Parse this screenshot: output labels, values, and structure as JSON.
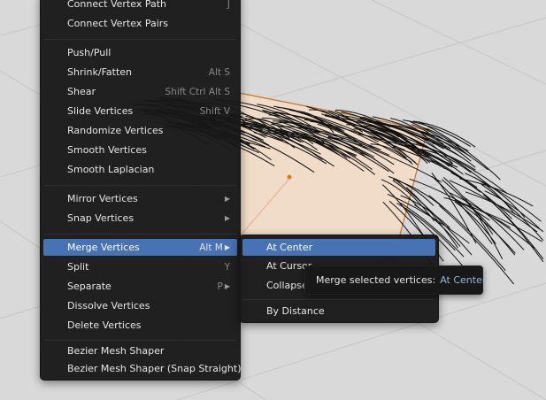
{
  "edge_menu": {
    "items": [
      {
        "label": "Connect Vertex Path",
        "shortcut": "J"
      },
      {
        "label": "Connect Vertex Pairs",
        "shortcut": ""
      },
      {
        "label": "Push/Pull",
        "shortcut": ""
      },
      {
        "label": "Shrink/Fatten",
        "shortcut": "Alt S"
      },
      {
        "label": "Shear",
        "shortcut": "Shift Ctrl Alt S"
      },
      {
        "label": "Slide Vertices",
        "shortcut": "Shift V"
      },
      {
        "label": "Randomize Vertices",
        "shortcut": ""
      },
      {
        "label": "Smooth Vertices",
        "shortcut": ""
      },
      {
        "label": "Smooth Laplacian",
        "shortcut": ""
      },
      {
        "label": "Mirror Vertices",
        "shortcut": "",
        "submenu": true
      },
      {
        "label": "Snap Vertices",
        "shortcut": "",
        "submenu": true
      },
      {
        "label": "Merge Vertices",
        "shortcut": "Alt M",
        "submenu": true,
        "active": true
      },
      {
        "label": "Split",
        "shortcut": "Y"
      },
      {
        "label": "Separate",
        "shortcut": "P",
        "submenu": true
      },
      {
        "label": "Dissolve Vertices",
        "shortcut": ""
      },
      {
        "label": "Delete Vertices",
        "shortcut": ""
      },
      {
        "label": "Bezier Mesh Shaper",
        "shortcut": ""
      },
      {
        "label": "Bezier Mesh Shaper (Snap Straight)",
        "shortcut": ""
      }
    ]
  },
  "merge_submenu": {
    "items": [
      {
        "label": "At Center",
        "active": true
      },
      {
        "label": "At Cursor"
      },
      {
        "label": "Collapse"
      },
      {
        "label": "By Distance"
      }
    ]
  },
  "tooltip": {
    "text": "Merge selected vertices:",
    "value": "At Center"
  },
  "colors": {
    "menu_bg": "#181818",
    "highlight": "#4772b3",
    "viewport_bg": "#d9d9d9",
    "face_fill": "#f0dcc8",
    "edge_orange": "#c87528"
  }
}
